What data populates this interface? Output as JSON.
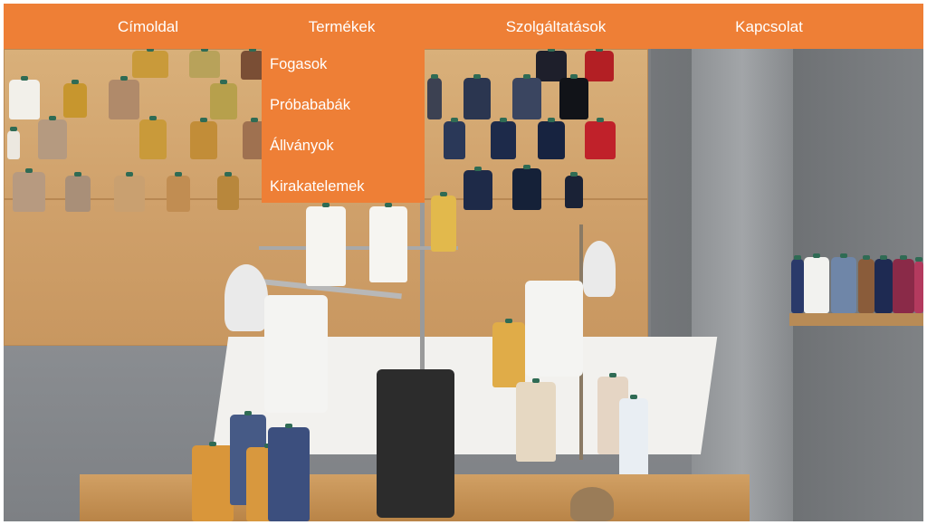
{
  "nav": {
    "items": [
      {
        "label": "Címoldal"
      },
      {
        "label": "Termékek"
      },
      {
        "label": "Szolgáltatások"
      },
      {
        "label": "Kapcsolat"
      }
    ],
    "dropdown": {
      "items": [
        {
          "label": "Fogasok"
        },
        {
          "label": "Próbababák"
        },
        {
          "label": "Állványok"
        },
        {
          "label": "Kirakatelemek"
        }
      ]
    }
  },
  "colors": {
    "nav_background": "#ee7f36",
    "nav_text": "#ffffff"
  },
  "hero": {
    "image": "sewing-workshop-photo"
  }
}
